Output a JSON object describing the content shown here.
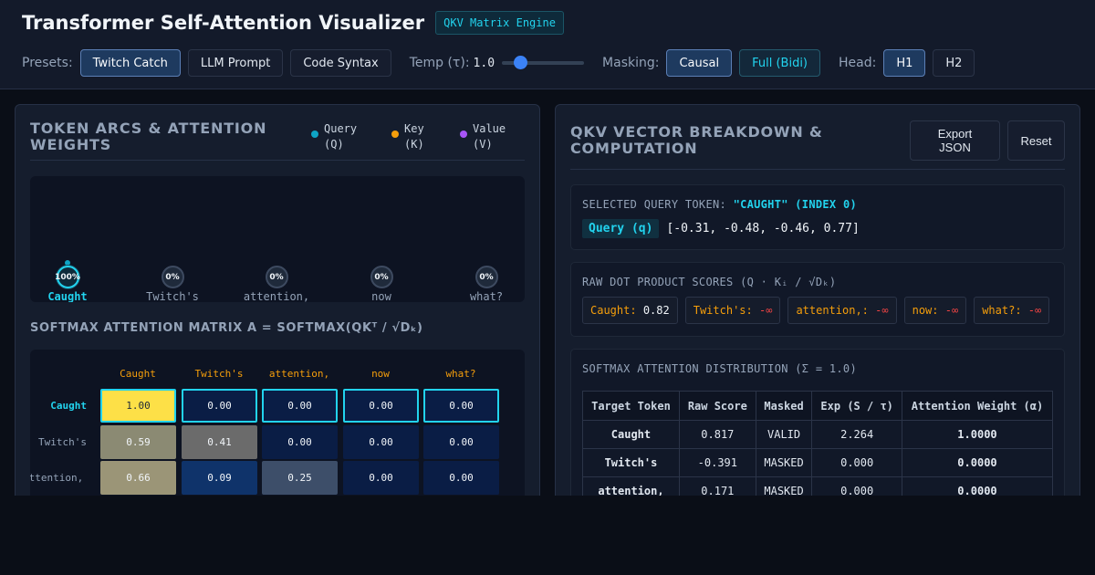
{
  "header": {
    "title": "Transformer Self-Attention Visualizer",
    "badge": "QKV Matrix Engine",
    "presets_label": "Presets:",
    "presets": [
      "Twitch Catch",
      "LLM Prompt",
      "Code Syntax"
    ],
    "active_preset": "Twitch Catch",
    "temp_label": "Temp (τ):",
    "temp_value": "1.0",
    "temp_slider_fraction": 0.22,
    "masking_label": "Masking:",
    "masking_options": [
      "Causal",
      "Full (Bidi)"
    ],
    "active_masking": "Causal",
    "head_label": "Head:",
    "heads": [
      "H1",
      "H2"
    ],
    "active_head": "H1"
  },
  "left_panel": {
    "title_line1": "TOKEN ARCS & ATTENTION",
    "title_line2": "WEIGHTS",
    "legend": [
      {
        "line1": "Query",
        "line2": "(Q)",
        "color": "#0ea5c6"
      },
      {
        "line1": "Key",
        "line2": "(K)",
        "color": "#f59e0b"
      },
      {
        "line1": "Value",
        "line2": "(V)",
        "color": "#a855f7"
      }
    ],
    "tokens": [
      {
        "label": "Caught",
        "pct": "100%",
        "selected": true
      },
      {
        "label": "Twitch's",
        "pct": "0%"
      },
      {
        "label": "attention,",
        "pct": "0%"
      },
      {
        "label": "now",
        "pct": "0%"
      },
      {
        "label": "what?",
        "pct": "0%"
      }
    ],
    "matrix_title": "SOFTMAX ATTENTION MATRIX A = SOFTMAX(QKᵀ / √Dₖ)",
    "matrix": {
      "col_headers": [
        "Caught",
        "Twitch's",
        "attention,",
        "now",
        "what?"
      ],
      "rows": [
        {
          "label": "Caught",
          "values": [
            "1.00",
            "0.00",
            "0.00",
            "0.00",
            "0.00"
          ]
        },
        {
          "label": "Twitch's",
          "values": [
            "0.59",
            "0.41",
            "0.00",
            "0.00",
            "0.00"
          ]
        },
        {
          "label": "attention,",
          "values": [
            "0.66",
            "0.09",
            "0.25",
            "0.00",
            "0.00"
          ]
        }
      ]
    }
  },
  "right_panel": {
    "title_line1": "QKV VECTOR BREAKDOWN &",
    "title_line2": "COMPUTATION",
    "export_line1": "Export",
    "export_line2": "JSON",
    "reset_label": "Reset",
    "selected_label": "SELECTED QUERY TOKEN:",
    "selected_value": "\"CAUGHT\" (INDEX 0)",
    "query_chip": "Query (q)",
    "query_vector": "[-0.31, -0.48, -0.46, 0.77]",
    "raw_label": "RAW DOT PRODUCT SCORES (Q · Kᵢ / √Dₖ)",
    "raw_scores": [
      {
        "key": "Caught:",
        "value": "0.82"
      },
      {
        "key": "Twitch's:",
        "value": "-∞"
      },
      {
        "key": "attention,:",
        "value": "-∞"
      },
      {
        "key": "now:",
        "value": "-∞"
      },
      {
        "key": "what?:",
        "value": "-∞"
      }
    ],
    "dist_label": "SOFTMAX ATTENTION DISTRIBUTION (Σ = 1.0)",
    "table": {
      "headers": [
        "Target Token",
        "Raw Score",
        "Masked",
        "Exp (S / τ)",
        "Attention Weight (α)"
      ],
      "rows": [
        [
          "Caught",
          "0.817",
          "VALID",
          "2.264",
          "1.0000"
        ],
        [
          "Twitch's",
          "-0.391",
          "MASKED",
          "0.000",
          "0.0000"
        ],
        [
          "attention,",
          "0.171",
          "MASKED",
          "0.000",
          "0.0000"
        ]
      ]
    }
  }
}
